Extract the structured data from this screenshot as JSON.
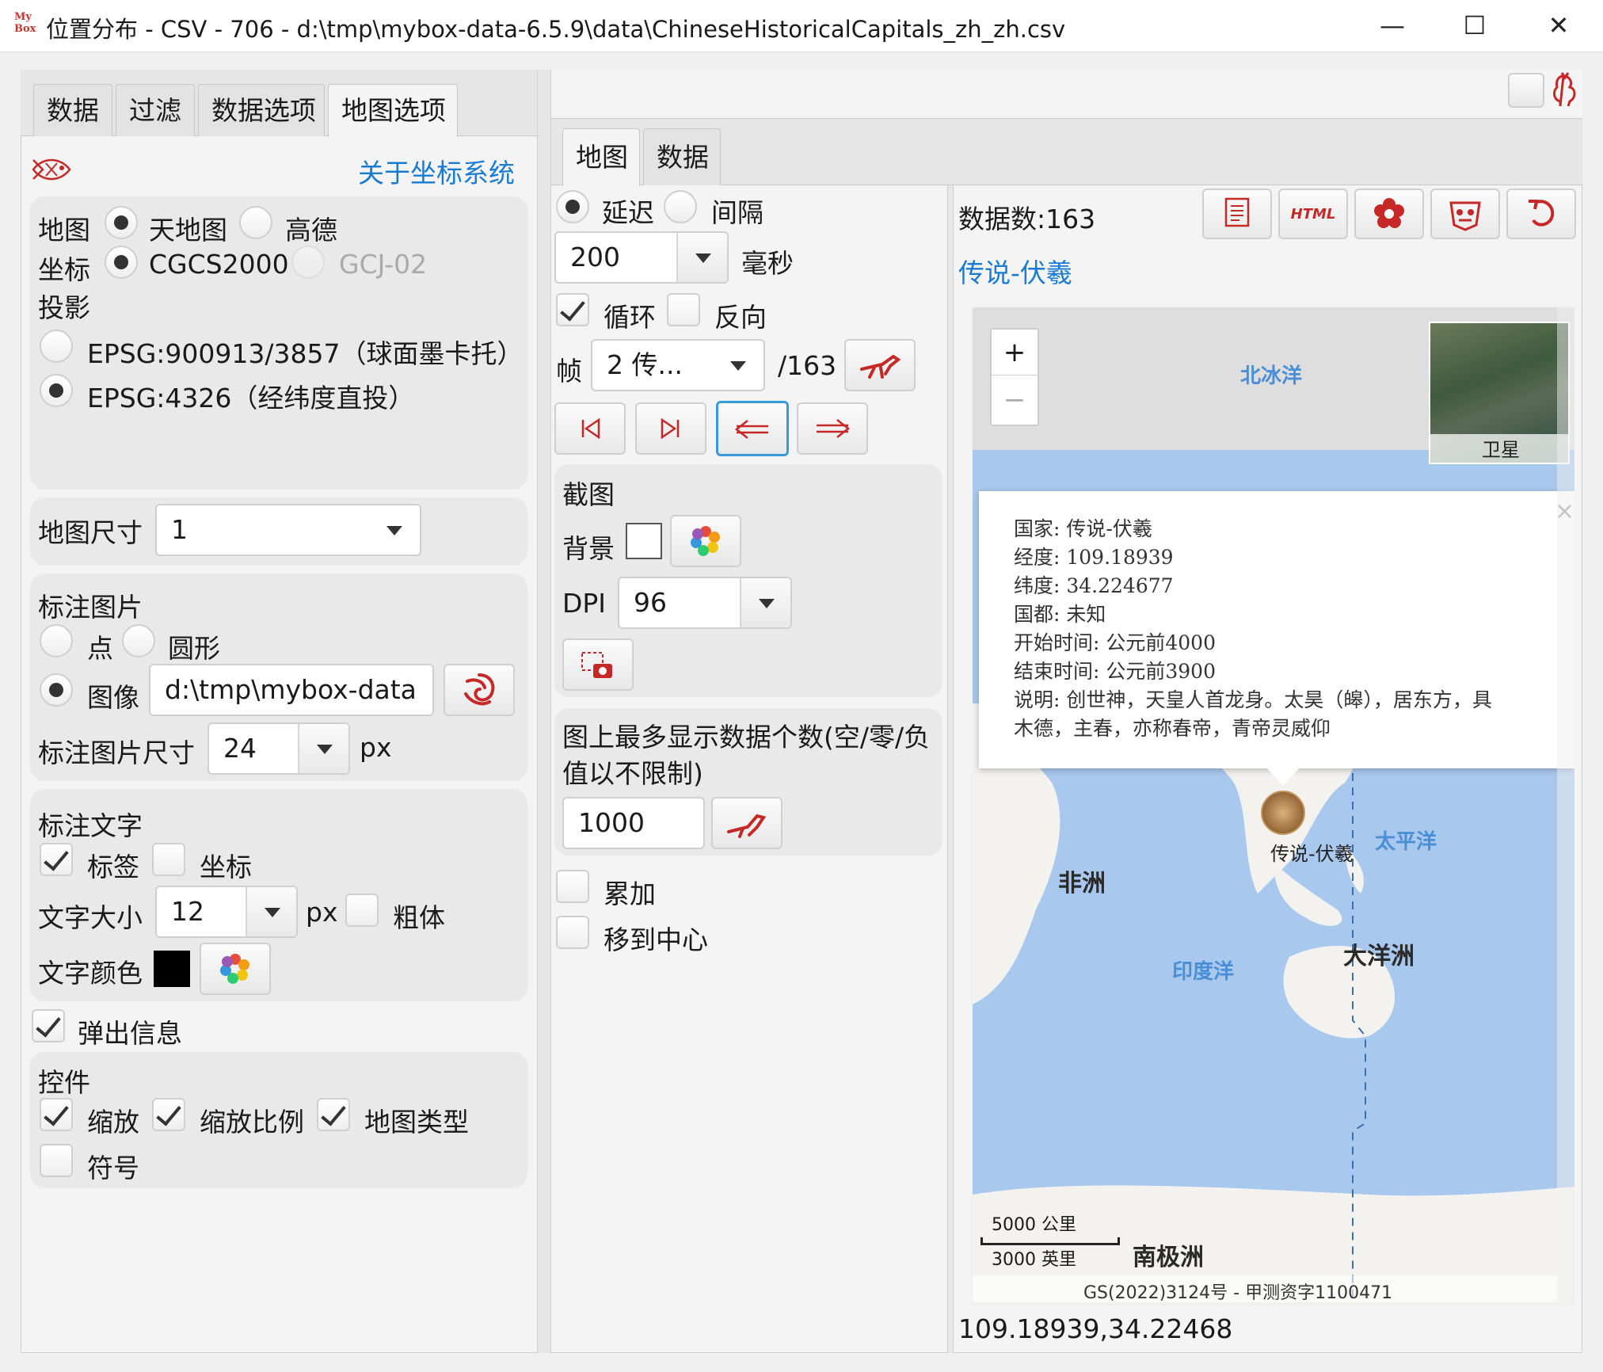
{
  "window": {
    "logo": "My Box",
    "title": "位置分布 - CSV - 706 - d:\\tmp\\mybox-data-6.5.9\\data\\ChineseHistoricalCapitals_zh_zh.csv",
    "minimize": "—",
    "maximize": "☐",
    "close": "✕"
  },
  "left": {
    "tabs": [
      "数据",
      "过滤",
      "数据选项",
      "地图选项"
    ],
    "about_coords": "关于坐标系统",
    "map_label": "地图",
    "map_options": [
      "天地图",
      "高德"
    ],
    "coord_label": "坐标",
    "coord_options": [
      "CGCS2000",
      "GCJ-02"
    ],
    "projection_label": "投影",
    "projection_options": [
      "EPSG:900913/3857（球面墨卡托）",
      "EPSG:4326（经纬度直投）"
    ],
    "map_size_label": "地图尺寸",
    "map_size_value": "1",
    "marker_image_title": "标注图片",
    "marker_point": "点",
    "marker_circle": "圆形",
    "marker_image": "图像",
    "marker_image_path": "d:\\tmp\\mybox-data",
    "marker_size_label": "标注图片尺寸",
    "marker_size_value": "24",
    "px": "px",
    "marker_text_title": "标注文字",
    "text_label": "标签",
    "text_coord": "坐标",
    "text_size_label": "文字大小",
    "text_size_value": "12",
    "bold_label": "粗体",
    "text_color_label": "文字颜色",
    "popup_label": "弹出信息",
    "controls_title": "控件",
    "ctrl_zoom": "缩放",
    "ctrl_scale": "缩放比例",
    "ctrl_maptype": "地图类型",
    "ctrl_symbol": "符号"
  },
  "right": {
    "tabs": [
      "地图",
      "数据"
    ],
    "delay_label": "延迟",
    "interval_label": "间隔",
    "delay_value": "200",
    "ms_label": "毫秒",
    "loop_label": "循环",
    "reverse_label": "反向",
    "frame_label": "帧",
    "frame_value": "2 传...",
    "frame_total": "/163",
    "snapshot_title": "截图",
    "bg_label": "背景",
    "dpi_label": "DPI",
    "dpi_value": "96",
    "max_display_label": "图上最多显示数据个数(空/零/负值以不限制)",
    "max_display_value": "1000",
    "accumulate_label": "累加",
    "move_center_label": "移到中心",
    "data_count": "数据数:163",
    "current_title": "传说-伏羲",
    "html_btn": "HTML",
    "coords_readout": "109.18939,34.22468"
  },
  "map": {
    "zoom_in": "+",
    "zoom_out": "−",
    "satellite_label": "卫星",
    "oceans": {
      "arctic": "北冰洋",
      "pacific": "太平洋",
      "indian": "印度洋"
    },
    "continents": {
      "africa": "非洲",
      "oceania": "大洋洲",
      "antarctica": "南极洲"
    },
    "marker_label": "传说-伏羲",
    "scale_km": "5000 公里",
    "scale_mi": "3000 英里",
    "attribution": "GS(2022)3124号 - 甲测资字1100471",
    "popup": {
      "close": "×",
      "lines": [
        "国家: 传说-伏羲",
        "经度: 109.18939",
        "纬度: 34.224677",
        "国都: 未知",
        "开始时间: 公元前4000",
        "结束时间: 公元前3900",
        "说明: 创世神，天皇人首龙身。太昊（皞），居东方，具",
        "木德，主春，亦称春帝，青帝灵威仰"
      ]
    }
  },
  "colors": {
    "accent": "#c62828",
    "link": "#1a7bd0",
    "ocean": "#a9c8ee",
    "land": "#f3f2ee",
    "focus": "#3a9ad9"
  }
}
